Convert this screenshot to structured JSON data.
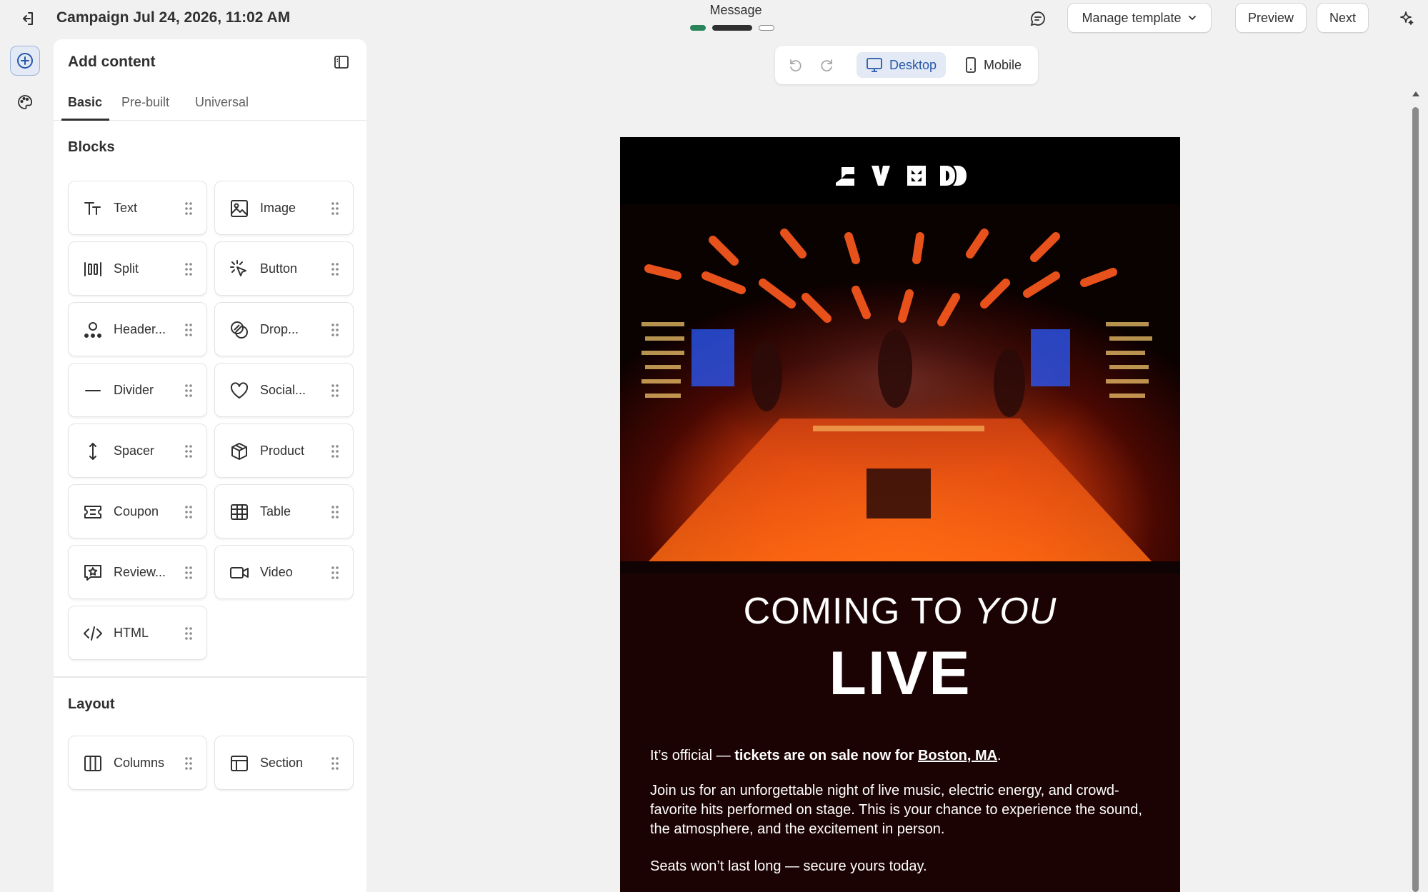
{
  "topbar": {
    "campaign_title": "Campaign Jul 24, 2026, 11:02 AM",
    "step_label": "Message",
    "manage_template_label": "Manage template",
    "preview_label": "Preview",
    "next_label": "Next"
  },
  "panel": {
    "title": "Add content",
    "tabs": [
      {
        "label": "Basic",
        "active": true
      },
      {
        "label": "Pre-built",
        "active": false
      },
      {
        "label": "Universal",
        "active": false
      }
    ],
    "blocks_heading": "Blocks",
    "blocks": [
      {
        "label": "Text",
        "icon": "text-icon"
      },
      {
        "label": "Image",
        "icon": "image-icon"
      },
      {
        "label": "Split",
        "icon": "split-icon"
      },
      {
        "label": "Button",
        "icon": "cursor-click-icon"
      },
      {
        "label": "Header...",
        "icon": "header-icon"
      },
      {
        "label": "Drop...",
        "icon": "drop-shadow-icon"
      },
      {
        "label": "Divider",
        "icon": "divider-icon"
      },
      {
        "label": "Social...",
        "icon": "heart-icon"
      },
      {
        "label": "Spacer",
        "icon": "spacer-icon"
      },
      {
        "label": "Product",
        "icon": "product-box-icon"
      },
      {
        "label": "Coupon",
        "icon": "coupon-icon"
      },
      {
        "label": "Table",
        "icon": "table-icon"
      },
      {
        "label": "Review...",
        "icon": "review-star-icon"
      },
      {
        "label": "Video",
        "icon": "video-icon"
      },
      {
        "label": "HTML",
        "icon": "code-icon"
      }
    ],
    "layout_heading": "Layout",
    "layout_blocks": [
      {
        "label": "Columns",
        "icon": "columns-icon"
      },
      {
        "label": "Section",
        "icon": "section-icon"
      }
    ]
  },
  "canvas_toolbar": {
    "desktop_label": "Desktop",
    "mobile_label": "Mobile",
    "active_view": "Desktop"
  },
  "email": {
    "headline_1_prefix": "COMING TO ",
    "headline_1_emphasis": "YOU",
    "headline_2": "LIVE",
    "p1_prefix": "It’s official — ",
    "p1_bold": "tickets are on sale now for ",
    "p1_link": "Boston, MA",
    "p1_suffix": ".",
    "p2": "Join us for an unforgettable night of live music, electric energy, and crowd-favorite hits performed on stage. This is your chance to experience the sound, the atmosphere, and the excitement in person.",
    "p3": "Seats won’t last long — secure yours today."
  },
  "colors": {
    "accent_green": "#29845a",
    "selected_blue": "#2659a8",
    "email_body_bg": "#1c0303"
  }
}
